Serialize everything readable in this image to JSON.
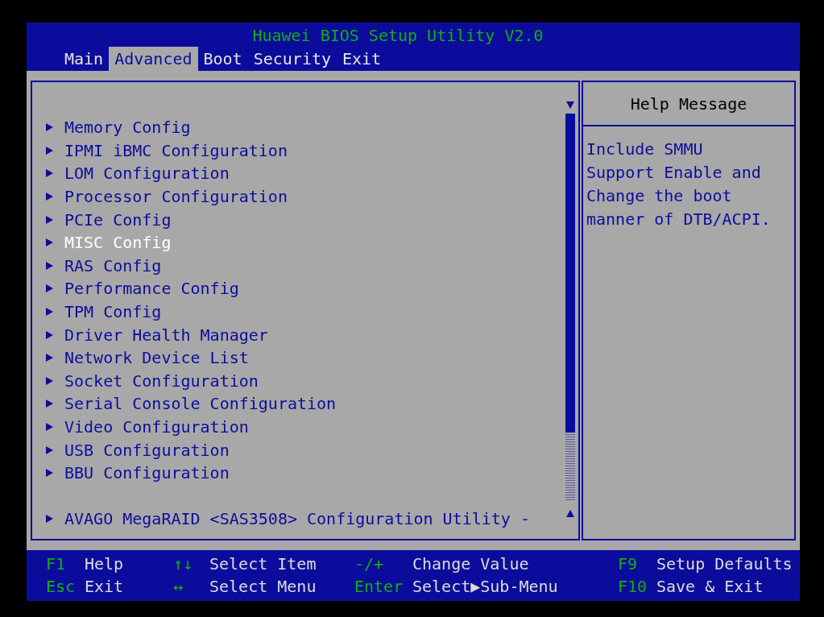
{
  "title": "Huawei BIOS Setup Utility V2.0",
  "tabs": [
    {
      "label": "Main",
      "selected": false
    },
    {
      "label": "Advanced",
      "selected": true
    },
    {
      "label": "Boot",
      "selected": false
    },
    {
      "label": "Security",
      "selected": false
    },
    {
      "label": "Exit",
      "selected": false
    }
  ],
  "menu_groups": [
    {
      "items": [
        {
          "label": "Memory Config",
          "selected": false
        },
        {
          "label": "IPMI iBMC Configuration",
          "selected": false
        },
        {
          "label": "LOM Configuration",
          "selected": false
        },
        {
          "label": "Processor Configuration",
          "selected": false
        },
        {
          "label": "PCIe Config",
          "selected": false
        },
        {
          "label": "MISC Config",
          "selected": true
        },
        {
          "label": "RAS Config",
          "selected": false
        },
        {
          "label": "Performance Config",
          "selected": false
        },
        {
          "label": "TPM Config",
          "selected": false
        },
        {
          "label": "Driver Health Manager",
          "selected": false
        },
        {
          "label": "Network Device List",
          "selected": false
        },
        {
          "label": "Socket Configuration",
          "selected": false
        },
        {
          "label": "Serial Console Configuration",
          "selected": false
        },
        {
          "label": "Video Configuration",
          "selected": false
        },
        {
          "label": "USB Configuration",
          "selected": false
        },
        {
          "label": "BBU Configuration",
          "selected": false
        }
      ]
    },
    {
      "items": [
        {
          "label": "AVAGO MegaRAID <SAS3508> Configuration Utility -",
          "selected": false
        }
      ]
    }
  ],
  "help": {
    "title": "Help Message",
    "text": "Include SMMU Support Enable and Change the boot manner of DTB/ACPI."
  },
  "hints": [
    {
      "key": "F1",
      "desc": "Help"
    },
    {
      "key": "↑↓",
      "desc": "Select Item"
    },
    {
      "key": "-/+",
      "desc": "Change Value"
    },
    {
      "key": "F9",
      "desc": "Setup Defaults"
    },
    {
      "key": "Esc",
      "desc": "Exit"
    },
    {
      "key": "↔",
      "desc": "Select Menu"
    },
    {
      "key": "Enter",
      "desc": "Select▶Sub-Menu"
    },
    {
      "key": "F10",
      "desc": "Save & Exit"
    }
  ]
}
